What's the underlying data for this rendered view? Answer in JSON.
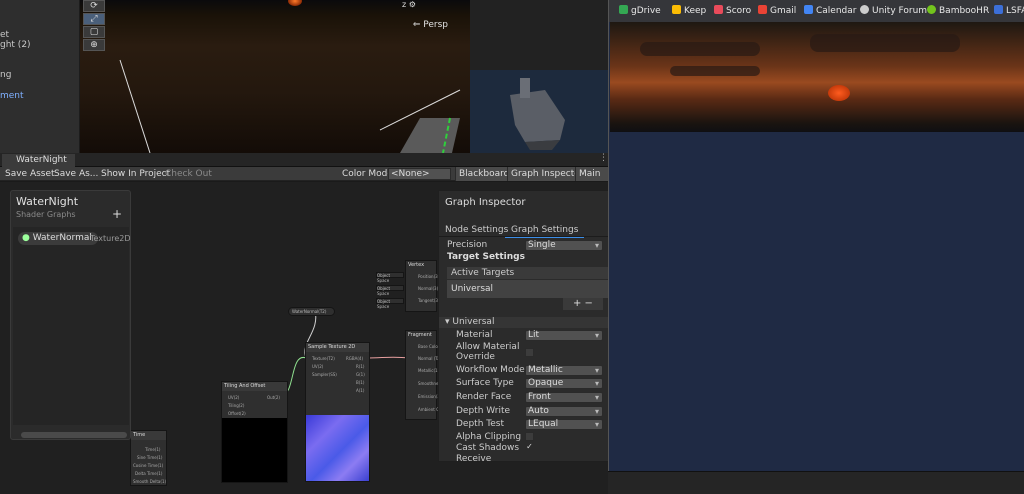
{
  "hierarchy": {
    "line1": "et",
    "line2": "ght (2)",
    "line3": "ng",
    "line4": "ment"
  },
  "scene": {
    "tools": [
      "⟳",
      "⤢",
      "▢",
      "⊕"
    ],
    "gizmo_label": "z",
    "persp_label": "⇐ Persp"
  },
  "shader_graph": {
    "tab_title": "WaterNight",
    "toolbar": {
      "save_asset": "Save Asset",
      "save_as": "Save As...",
      "show_in_project": "Show In Project",
      "check_out": "Check Out",
      "color_mode_label": "Color Mode",
      "color_mode_value": "<None>",
      "blackboard": "Blackboard",
      "graph_inspector": "Graph Inspector",
      "main_preview": "Main Pre"
    },
    "blackboard": {
      "title": "WaterNight",
      "subtitle": "Shader Graphs",
      "add": "+",
      "property_name": "WaterNormal",
      "property_type": "Texture2D"
    },
    "nodes": {
      "vertex": "Vertex",
      "fragment": "Fragment",
      "sample_texture": "Sample Texture 2D",
      "tiling_offset": "Tiling And Offset",
      "time": "Time",
      "water_normal_pill": "WaterNormal(T2)"
    },
    "inspector": {
      "title": "Graph Inspector",
      "tab_node": "Node Settings",
      "tab_graph": "Graph Settings",
      "precision_label": "Precision",
      "precision_value": "Single",
      "target_settings": "Target Settings",
      "active_targets": "Active Targets",
      "target_universal": "Universal",
      "add_remove": "+ −",
      "section_universal": "Universal",
      "material_label": "Material",
      "material_value": "Lit",
      "allow_override_label": "Allow Material Override",
      "workflow_label": "Workflow Mode",
      "workflow_value": "Metallic",
      "surface_label": "Surface Type",
      "surface_value": "Opaque",
      "render_face_label": "Render Face",
      "render_face_value": "Front",
      "depth_write_label": "Depth Write",
      "depth_write_value": "Auto",
      "depth_test_label": "Depth Test",
      "depth_test_value": "LEqual",
      "alpha_clip_label": "Alpha Clipping",
      "cast_shadows_label": "Cast Shadows",
      "receive_label": "Receive"
    }
  },
  "browser": {
    "bookmarks": [
      {
        "label": "gDrive",
        "color": "#34a853"
      },
      {
        "label": "Keep",
        "color": "#fbbc04"
      },
      {
        "label": "Scoro",
        "color": "#e94b5b"
      },
      {
        "label": "Gmail",
        "color": "#ea4335"
      },
      {
        "label": "Calendar",
        "color": "#4285f4"
      },
      {
        "label": "Unity Forum",
        "color": "#cccccc"
      },
      {
        "label": "BambooHR",
        "color": "#73c41d"
      },
      {
        "label": "LSFA",
        "color": "#3c6fd8"
      }
    ]
  },
  "colors": {
    "accent_blue": "#3c8ee8",
    "panel": "#2b2b2b",
    "canvas": "#202020"
  }
}
